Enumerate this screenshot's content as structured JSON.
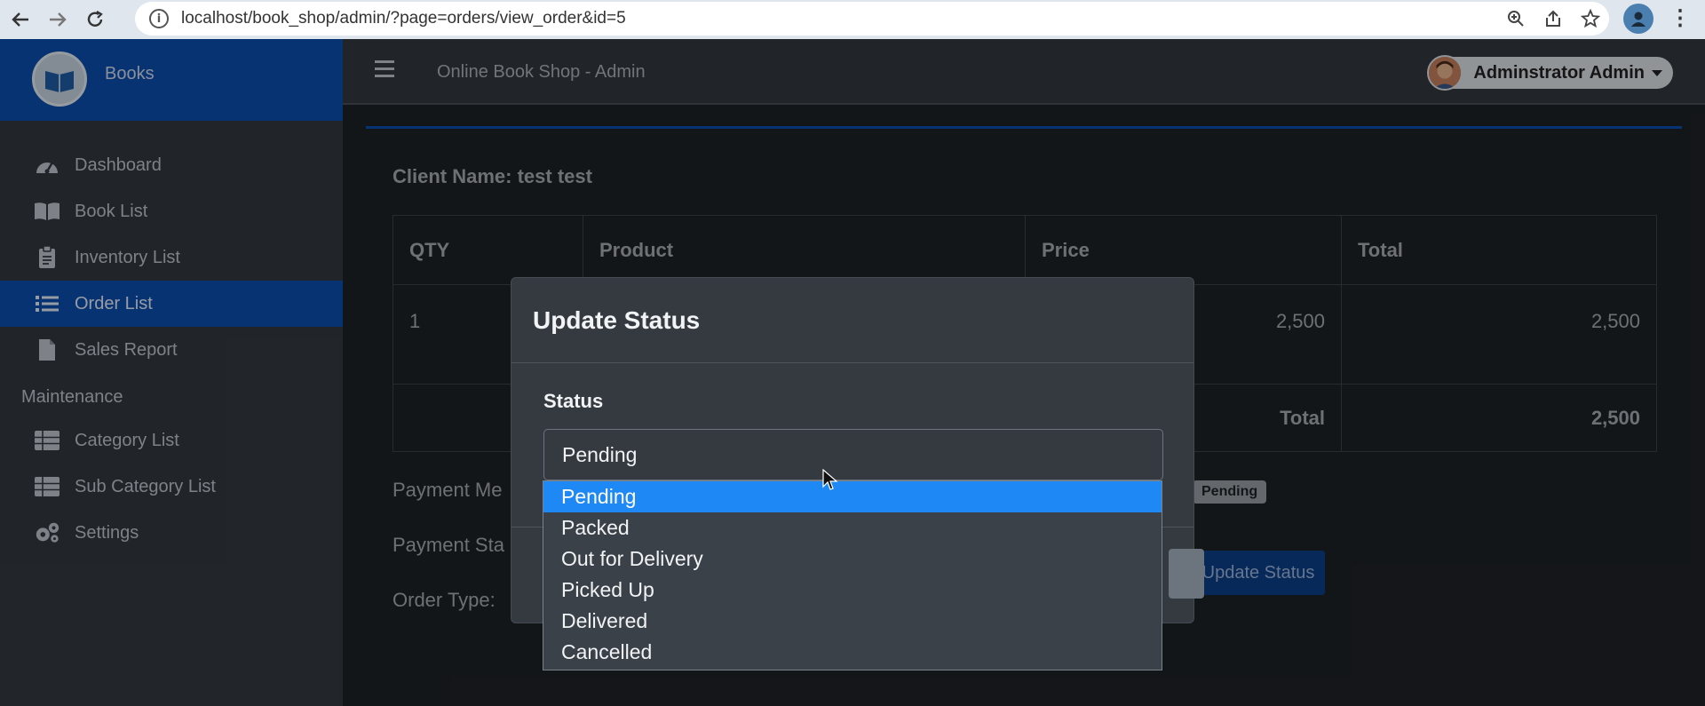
{
  "browser": {
    "url": "localhost/book_shop/admin/?page=orders/view_order&id=5"
  },
  "sidebar": {
    "brand": "Books",
    "items": [
      {
        "label": "Dashboard",
        "icon": "dashboard-icon"
      },
      {
        "label": "Book List",
        "icon": "book-icon"
      },
      {
        "label": "Inventory List",
        "icon": "clipboard-icon"
      },
      {
        "label": "Order List",
        "icon": "list-icon",
        "active": true
      },
      {
        "label": "Sales Report",
        "icon": "file-icon"
      }
    ],
    "maintenance_header": "Maintenance",
    "maintenance_items": [
      {
        "label": "Category List",
        "icon": "table-icon"
      },
      {
        "label": "Sub Category List",
        "icon": "table-icon"
      },
      {
        "label": "Settings",
        "icon": "gears-icon"
      }
    ]
  },
  "topbar": {
    "title": "Online Book Shop - Admin",
    "user": "Adminstrator Admin"
  },
  "order": {
    "client_name": "Client Name: test test",
    "columns": [
      "QTY",
      "Product",
      "Price",
      "Total"
    ],
    "rows": [
      {
        "qty": "1",
        "product": "",
        "price": "2,500",
        "total": "2,500"
      }
    ],
    "total_label": "Total",
    "total_value": "2,500",
    "payment_method_label": "Payment Me",
    "payment_status_label": "Payment Sta",
    "order_type_label": "Order Type:",
    "status_badge": "Pending",
    "update_button": "Update Status"
  },
  "modal": {
    "title": "Update Status",
    "field_label": "Status",
    "selected_value": "Pending",
    "options": [
      "Pending",
      "Packed",
      "Out for Delivery",
      "Picked Up",
      "Delivered",
      "Cancelled"
    ]
  },
  "colors": {
    "accent": "#0d4fb0",
    "highlight": "#1e88f5",
    "sidebar_bg": "#343a40",
    "content_bg": "#1e2226"
  }
}
